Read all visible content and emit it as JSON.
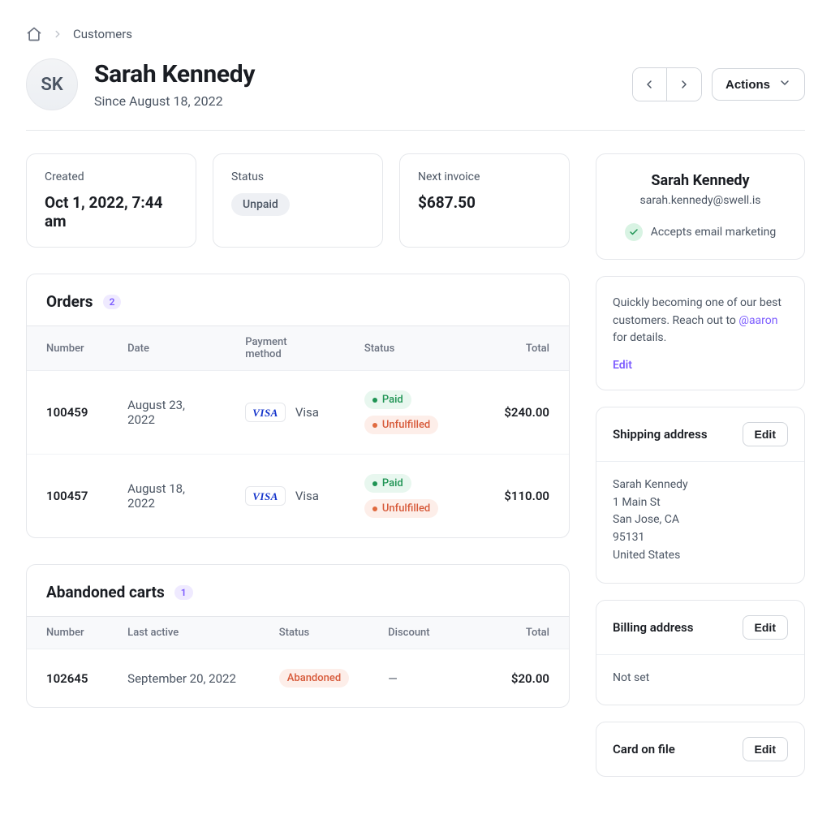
{
  "breadcrumb": {
    "customers_label": "Customers"
  },
  "header": {
    "avatar_initials": "SK",
    "name": "Sarah Kennedy",
    "since": "Since August 18, 2022",
    "actions_label": "Actions"
  },
  "stats": {
    "created_label": "Created",
    "created_value": "Oct 1, 2022, 7:44 am",
    "status_label": "Status",
    "status_value": "Unpaid",
    "next_invoice_label": "Next invoice",
    "next_invoice_value": "$687.50"
  },
  "orders": {
    "title": "Orders",
    "count": "2",
    "columns": {
      "number": "Number",
      "date": "Date",
      "pm": "Payment method",
      "status": "Status",
      "total": "Total"
    },
    "rows": [
      {
        "number": "100459",
        "date": "August 23, 2022",
        "pm_brand": "VISA",
        "pm_label": "Visa",
        "paid": "Paid",
        "fulfil": "Unfulfilled",
        "total": "$240.00"
      },
      {
        "number": "100457",
        "date": "August 18, 2022",
        "pm_brand": "VISA",
        "pm_label": "Visa",
        "paid": "Paid",
        "fulfil": "Unfulfilled",
        "total": "$110.00"
      }
    ]
  },
  "carts": {
    "title": "Abandoned carts",
    "count": "1",
    "columns": {
      "number": "Number",
      "last_active": "Last active",
      "status": "Status",
      "discount": "Discount",
      "total": "Total"
    },
    "rows": [
      {
        "number": "102645",
        "last_active": "September 20, 2022",
        "status": "Abandoned",
        "discount": "—",
        "total": "$20.00"
      }
    ]
  },
  "profile": {
    "name": "Sarah Kennedy",
    "email": "sarah.kennedy@swell.is",
    "accepts_label": "Accepts email marketing"
  },
  "note": {
    "prefix": "Quickly becoming one of our best customers. Reach out to ",
    "mention": "@aaron",
    "suffix": " for details.",
    "edit": "Edit"
  },
  "shipping": {
    "title": "Shipping address",
    "edit": "Edit",
    "name": "Sarah Kennedy",
    "line1": "1 Main St",
    "city_state": "San Jose, CA",
    "zip": "95131",
    "country": "United States"
  },
  "billing": {
    "title": "Billing address",
    "edit": "Edit",
    "value": "Not set"
  },
  "card": {
    "title": "Card on file",
    "edit": "Edit"
  }
}
